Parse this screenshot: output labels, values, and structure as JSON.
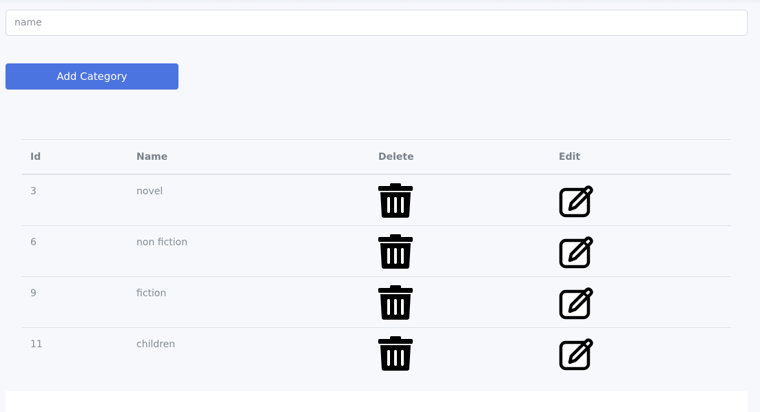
{
  "form": {
    "name_placeholder": "name",
    "name_value": "",
    "add_button_label": "Add Category"
  },
  "table": {
    "headers": {
      "id": "Id",
      "name": "Name",
      "delete": "Delete",
      "edit": "Edit"
    },
    "rows": [
      {
        "id": "3",
        "name": "novel"
      },
      {
        "id": "6",
        "name": "non fiction"
      },
      {
        "id": "9",
        "name": "fiction"
      },
      {
        "id": "11",
        "name": "children"
      }
    ],
    "delete_icon": "trash-icon",
    "edit_icon": "edit-square-icon"
  },
  "colors": {
    "page_background": "#f6f8fc",
    "button": "#4c74e0",
    "button_text": "#ffffff",
    "header_text": "#7b828c",
    "cell_text": "#858b94",
    "row_border": "#dfe3e8"
  }
}
